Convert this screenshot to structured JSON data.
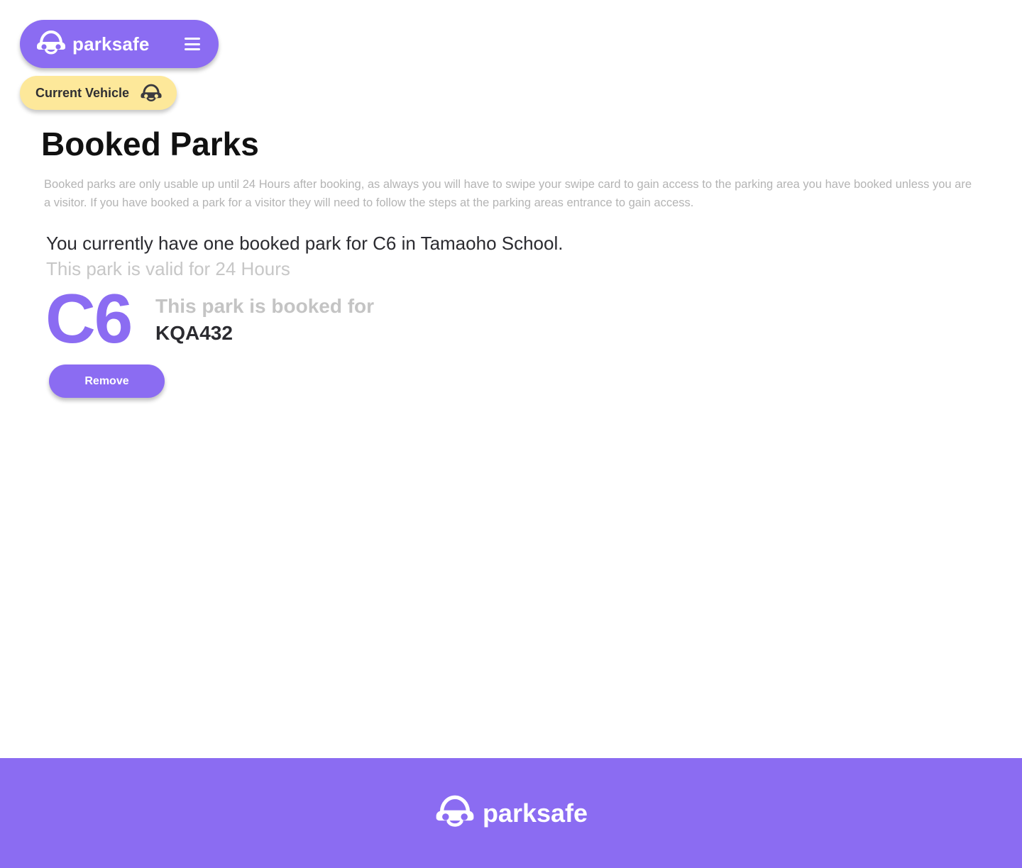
{
  "nav": {
    "brand": "parksafe",
    "logo_icon": "car-logo-icon",
    "menu_icon": "hamburger-menu-icon"
  },
  "vehicle": {
    "label": "Current Vehicle",
    "icon": "car-icon"
  },
  "main": {
    "title": "Booked Parks",
    "description": "Booked parks are only usable up until 24 Hours after booking, as always you will have to swipe your swipe card to gain access to the parking area you have booked unless you are a visitor. If you have booked a park for a visitor they will need to follow the steps at the parking areas entrance to gain access.",
    "summary": "You currently have one booked park for C6 in Tamaoho School.",
    "validity": "This park is valid for 24 Hours",
    "park_code": "C6",
    "booked_for_label": "This park is booked for",
    "plate": "KQA432",
    "remove_label": "Remove"
  },
  "footer": {
    "brand": "parksafe",
    "logo_icon": "car-logo-icon"
  },
  "colors": {
    "brand_purple": "#8b6cf2",
    "vehicle_yellow": "#fde89a",
    "muted_text": "#b4b4b4",
    "dark_text": "#2b2b30"
  }
}
